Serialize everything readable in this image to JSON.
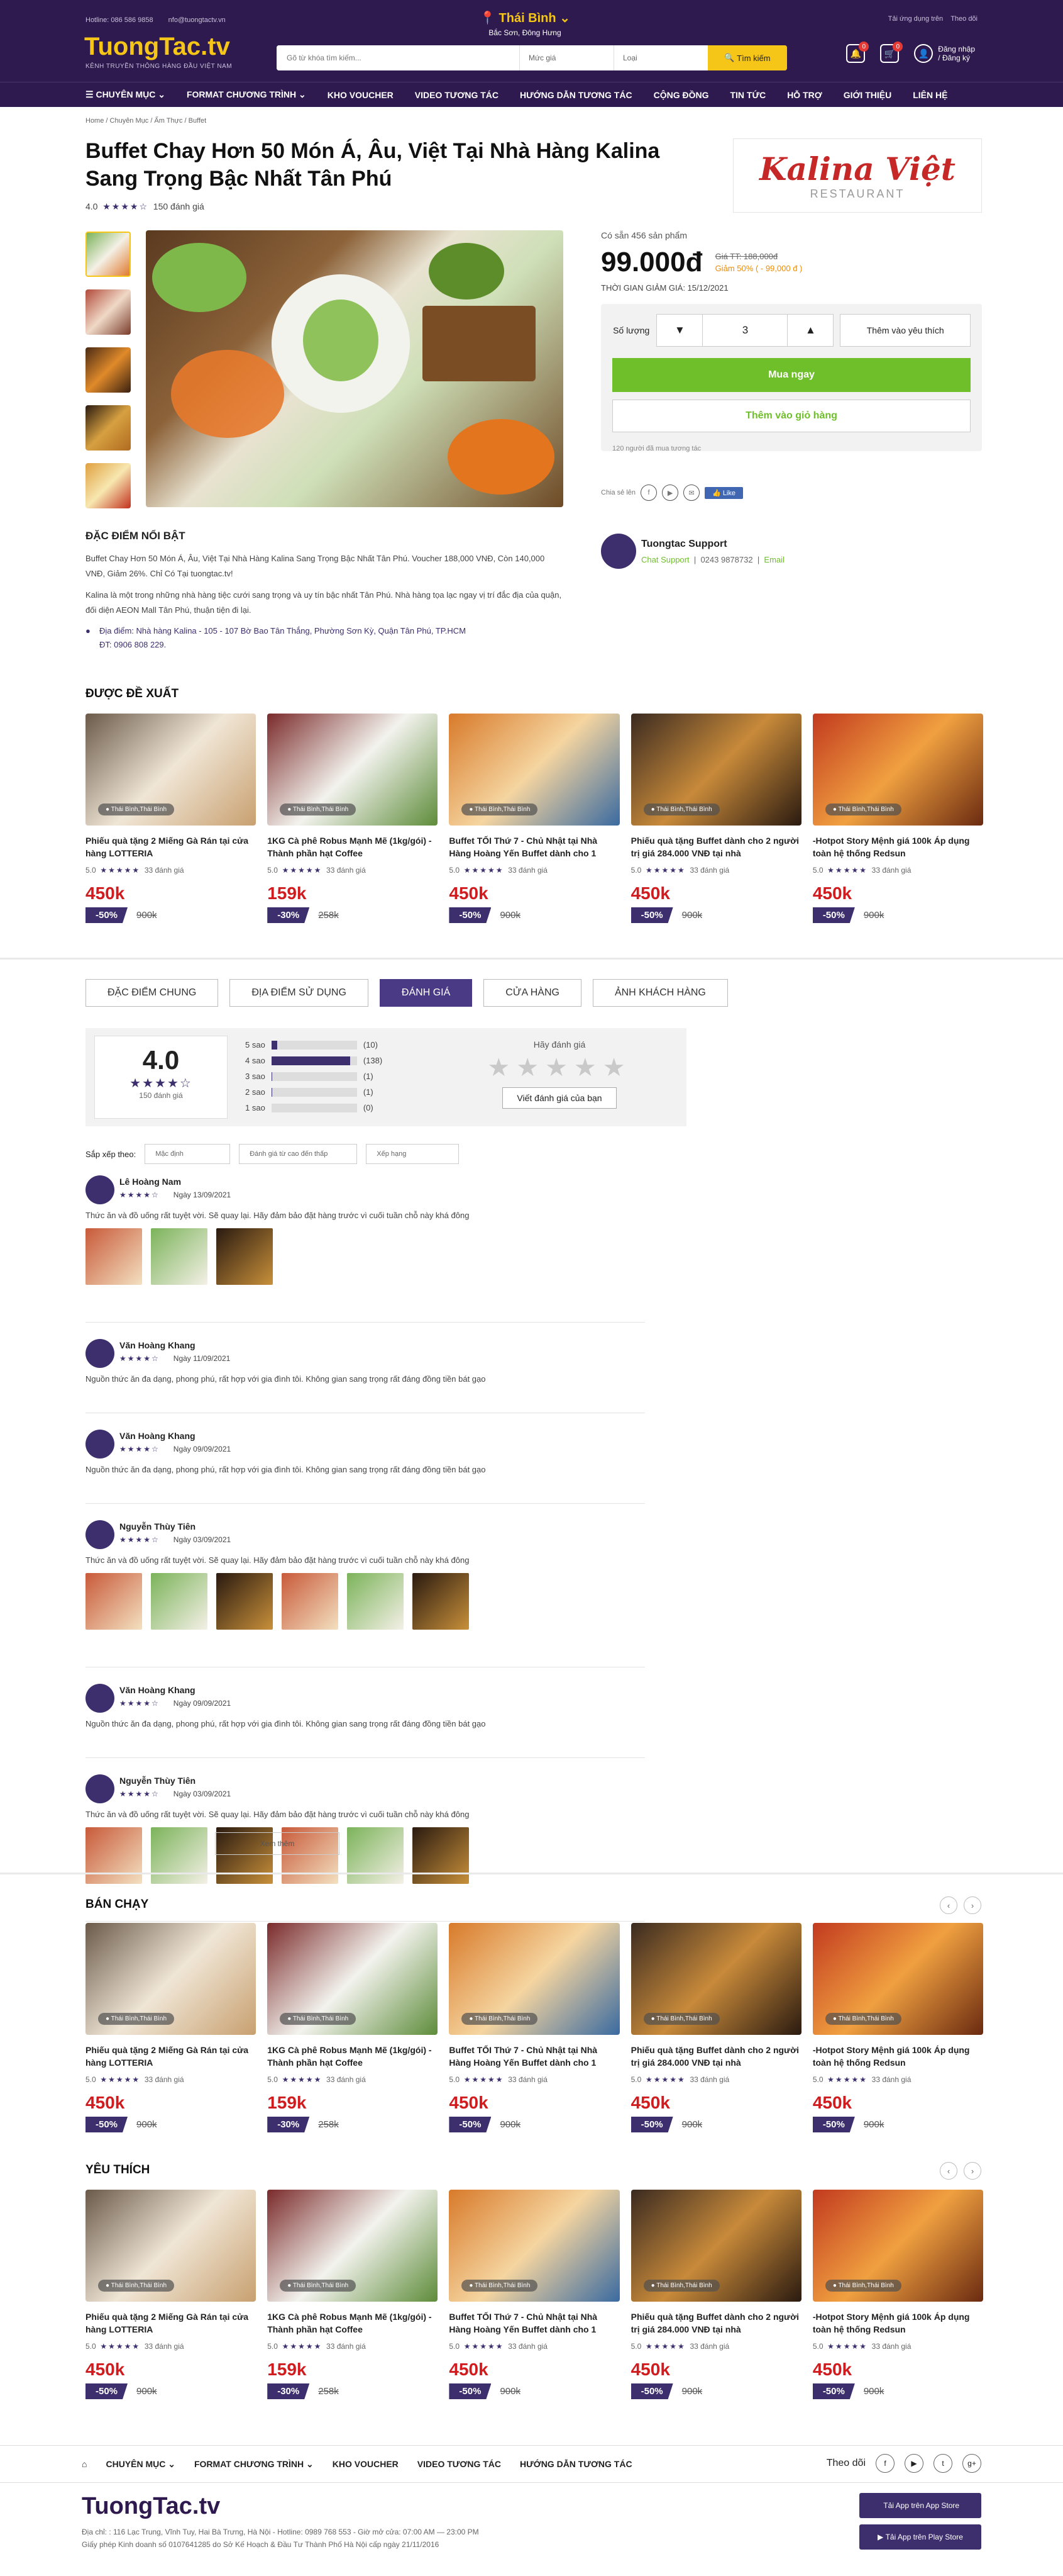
{
  "topbar": {
    "hotline": "Hotline: 086 586 9858",
    "email": "nfo@tuongtactv.vn",
    "logo": "TuongTac.tv",
    "logo_sub": "KÊNH TRUYỀN THÔNG HÀNG ĐẦU VIỆT NAM",
    "app_link": "Tải ứng dụng trên",
    "follow": "Theo dõi",
    "city": "Thái Bình",
    "city_sub": "Bắc Sơn, Đông Hưng",
    "search_placeholder": "Gõ từ khóa tìm kiếm...",
    "price_select": "Mức giá",
    "type_select": "Loại",
    "search_btn": "Tìm kiếm",
    "login": "Đăng nhập",
    "register": "/ Đăng ký",
    "cart_count": "0"
  },
  "nav": [
    "CHUYÊN MỤC",
    "FORMAT CHƯƠNG TRÌNH",
    "KHO VOUCHER",
    "VIDEO TƯƠNG TÁC",
    "HƯỚNG DẪN TƯƠNG TÁC",
    "CỘNG ĐỒNG",
    "TIN TỨC",
    "HỖ TRỢ",
    "GIỚI THIỆU",
    "LIÊN HỆ"
  ],
  "breadcrumb": "Home  /  Chuyên Mục  /  Ẩm Thực  /  Buffet",
  "product": {
    "title": "Buffet Chay Hơn 50 Món Á, Âu, Việt Tại Nhà Hàng Kalina Sang Trọng Bậc Nhất Tân Phú",
    "rating": "4.0",
    "reviews": "150 đánh giá",
    "brand_name": "Kalina Việt",
    "brand_sub": "RESTAURANT",
    "stock": "Có sẵn 456 sản phẩm",
    "price": "99.000đ",
    "old_price": "Giá TT: 188,000đ",
    "discount": "Giảm 50% ( - 99,000 đ )",
    "deadline": "THỜI GIAN GIẢM GIÁ: 15/12/2021",
    "qty_label": "Số lượng",
    "qty": "3",
    "wish": "Thêm vào yêu thích",
    "buy_now": "Mua ngay",
    "add_cart": "Thêm vào giỏ hàng",
    "interest": "120 người đã mua tương tác",
    "share": "Chia sẻ lên",
    "like": "Like"
  },
  "features": {
    "heading": "ĐẶC ĐIỂM NỔI BẬT",
    "p1": "Buffet Chay Hơn 50 Món Á, Âu, Việt Tại Nhà Hàng Kalina Sang Trọng Bậc Nhất Tân Phú. Voucher 188,000 VNĐ, Còn 140,000 VNĐ, Giảm 26%. Chỉ Có Tại tuongtac.tv!",
    "p2": "Kalina là một trong những nhà hàng tiệc cưới sang trọng và uy tín bậc nhất Tân Phú. Nhà hàng tọa lạc ngay vị trí đắc địa của quận, đối diện AEON Mall Tân Phú, thuận tiện đi lại.",
    "addr": "Địa điểm: Nhà hàng Kalina - 105 - 107 Bờ Bao Tân Thắng, Phường Sơn Kỳ, Quận Tân Phú, TP.HCM",
    "phone": "ĐT: 0906 808 229."
  },
  "support": {
    "name": "Tuongtac Support",
    "chat": "Chat Support",
    "phone": "0243 9878732",
    "email": "Email"
  },
  "sections": {
    "suggest": "ĐƯỢC ĐỀ XUẤT",
    "best": "BÁN CHẠY",
    "fav": "YÊU THÍCH"
  },
  "cards": [
    {
      "name": "Phiếu quà tặng 2 Miếng Gà Rán tại cửa hàng LOTTERIA",
      "loc": "Thái Bình,Thái Bình",
      "rating": "5.0",
      "count": "33 đánh giá",
      "price": "450k",
      "disc": "-50%",
      "old": "900k"
    },
    {
      "name": "1KG Cà phê Robus Mạnh Mẽ (1kg/gói) - Thành phần hạt Coffee",
      "loc": "Thái Bình,Thái Bình",
      "rating": "5.0",
      "count": "33 đánh giá",
      "price": "159k",
      "disc": "-30%",
      "old": "258k"
    },
    {
      "name": "Buffet TỐI Thứ 7 - Chủ Nhật tại Nhà Hàng Hoàng Yến Buffet dành cho 1",
      "loc": "Thái Bình,Thái Bình",
      "rating": "5.0",
      "count": "33 đánh giá",
      "price": "450k",
      "disc": "-50%",
      "old": "900k"
    },
    {
      "name": "Phiếu quà tặng Buffet dành cho 2 người trị giá 284.000 VNĐ tại nhà",
      "loc": "Thái Bình,Thái Bình",
      "rating": "5.0",
      "count": "33 đánh giá",
      "price": "450k",
      "disc": "-50%",
      "old": "900k"
    },
    {
      "name": "-Hotpot Story Mệnh giá 100k Áp dụng toàn hệ thống Redsun",
      "loc": "Thái Bình,Thái Bình",
      "rating": "5.0",
      "count": "33 đánh giá",
      "price": "450k",
      "disc": "-50%",
      "old": "900k"
    }
  ],
  "tabs": [
    "ĐẶC ĐIỂM CHUNG",
    "ĐỊA ĐIỂM SỬ DỤNG",
    "ĐÁNH GIÁ",
    "CỬA HÀNG",
    "ẢNH KHÁCH HÀNG"
  ],
  "summary": {
    "score": "4.0",
    "count": "150 đánh giá",
    "bars": [
      {
        "label": "5 sao",
        "n": "(10)",
        "pct": 0.07
      },
      {
        "label": "4 sao",
        "n": "(138)",
        "pct": 0.92
      },
      {
        "label": "3 sao",
        "n": "(1)",
        "pct": 0.01
      },
      {
        "label": "2 sao",
        "n": "(1)",
        "pct": 0.01
      },
      {
        "label": "1 sao",
        "n": "(0)",
        "pct": 0
      }
    ],
    "rate_prompt": "Hãy đánh giá",
    "write": "Viết đánh giá của bạn"
  },
  "sort": {
    "label": "Sắp xếp theo:",
    "s1": "Mặc định",
    "s2": "Đánh giá từ cao đến thấp",
    "s3": "Xếp hạng"
  },
  "reviews": [
    {
      "name": "Lê Hoàng Nam",
      "date": "Ngày 13/09/2021",
      "text": "Thức ăn và đồ uống rất tuyệt vời. Sẽ quay lại. Hãy đảm bảo đặt hàng trước vì cuối tuần chỗ này khá đông",
      "photos": 3
    },
    {
      "name": "Văn Hoàng Khang",
      "date": "Ngày 11/09/2021",
      "text": "Nguồn thức ăn đa dạng, phong phú, rất hợp với gia đình tôi. Không gian sang trọng rất đáng đồng tiền bát gạo",
      "photos": 0
    },
    {
      "name": "Văn Hoàng Khang",
      "date": "Ngày 09/09/2021",
      "text": "Nguồn thức ăn đa dạng, phong phú, rất hợp với gia đình tôi. Không gian sang trọng rất đáng đồng tiền bát gạo",
      "photos": 0
    },
    {
      "name": "Nguyễn Thùy Tiên",
      "date": "Ngày 03/09/2021",
      "text": "Thức ăn và đồ uống rất tuyệt vời. Sẽ quay lại. Hãy đảm bảo đặt hàng trước vì cuối tuần chỗ này khá đông",
      "photos": 6
    },
    {
      "name": "Văn Hoàng Khang",
      "date": "Ngày 09/09/2021",
      "text": "Nguồn thức ăn đa dạng, phong phú, rất hợp với gia đình tôi. Không gian sang trọng rất đáng đồng tiền bát gạo",
      "photos": 0
    },
    {
      "name": "Nguyễn Thùy Tiên",
      "date": "Ngày 03/09/2021",
      "text": "Thức ăn và đồ uống rất tuyệt vời. Sẽ quay lại. Hãy đảm bảo đặt hàng trước vì cuối tuần chỗ này khá đông",
      "photos": 6
    }
  ],
  "more": "Xem thêm",
  "footer": {
    "nav": [
      "CHUYÊN MỤC",
      "FORMAT CHƯƠNG TRÌNH",
      "KHO VOUCHER",
      "VIDEO TƯƠNG TÁC",
      "HƯỚNG DẪN TƯƠNG TÁC"
    ],
    "follow": "Theo dõi",
    "logo": "TuongTac.tv",
    "l1": "Địa chỉ: : 116 Lạc Trung, Vĩnh Tuy, Hai Bà Trưng, Hà Nội - Hotline: 0989 768 553 - Giờ mở cửa: 07:00 AM — 23:00 PM",
    "l2": "Giấy phép Kinh doanh số 0107641285 do Sở Kế Hoạch & Đầu Tư Thành Phố Hà Nội cấp ngày 21/11/2016",
    "app1": "Tải App trên App Store",
    "app2": "Tải App trên Play Store"
  }
}
